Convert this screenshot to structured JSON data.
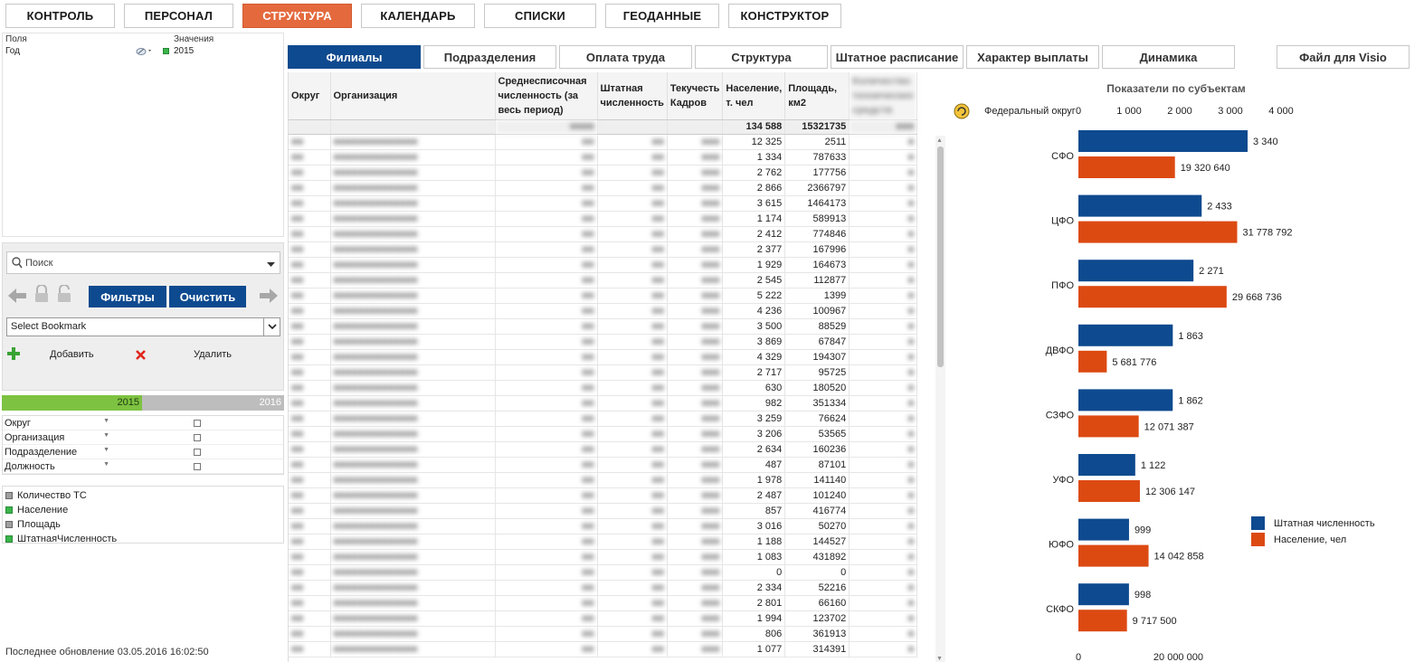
{
  "topnav": [
    {
      "label": "КОНТРОЛЬ",
      "active": false
    },
    {
      "label": "ПЕРСОНАЛ",
      "active": false
    },
    {
      "label": "СТРУКТУРА",
      "active": true
    },
    {
      "label": "КАЛЕНДАРЬ",
      "active": false
    },
    {
      "label": "СПИСКИ",
      "active": false
    },
    {
      "label": "ГЕОДАННЫЕ",
      "active": false
    },
    {
      "label": "КОНСТРУКТОР",
      "active": false
    }
  ],
  "fields": {
    "header_fields": "Поля",
    "header_values": "Значения",
    "field_name": "Год",
    "field_value": "2015"
  },
  "search": {
    "placeholder": "Поиск"
  },
  "toolbar": {
    "filters_label": "Фильтры",
    "clear_label": "Очистить"
  },
  "bookmarks": {
    "select_label": "Select Bookmark",
    "add_label": "Добавить",
    "delete_label": "Удалить"
  },
  "years": {
    "selected": "2015",
    "other": "2016"
  },
  "filters": [
    "Округ",
    "Организация",
    "Подразделение",
    "Должность"
  ],
  "metrics": [
    {
      "label": "Количество ТС",
      "checked": false
    },
    {
      "label": "Население",
      "checked": true
    },
    {
      "label": "Площадь",
      "checked": false
    },
    {
      "label": "ШтатнаяЧисленность",
      "checked": true
    }
  ],
  "last_update": "Последнее обновление 03.05.2016 16:02:50",
  "tabs": [
    "Филиалы",
    "Подразделения",
    "Оплата труда",
    "Структура",
    "Штатное расписание",
    "Характер выплаты",
    "Динамика"
  ],
  "visio_label": "Файл для Visio",
  "table": {
    "headers": [
      "Округ",
      "Организация",
      "Среднесписочная численность (за весь период)",
      "Штатная численность",
      "Текучесть Кадров",
      "Население, т. чел",
      "Площадь, км2",
      "Количество технических средств"
    ],
    "totals": {
      "population": "134 588",
      "area": "15321735"
    },
    "rows": [
      {
        "population": "12 325",
        "area": "2511"
      },
      {
        "population": "1 334",
        "area": "787633"
      },
      {
        "population": "2 762",
        "area": "177756"
      },
      {
        "population": "2 866",
        "area": "2366797"
      },
      {
        "population": "3 615",
        "area": "1464173"
      },
      {
        "population": "1 174",
        "area": "589913"
      },
      {
        "population": "2 412",
        "area": "774846"
      },
      {
        "population": "2 377",
        "area": "167996"
      },
      {
        "population": "1 929",
        "area": "164673"
      },
      {
        "population": "2 545",
        "area": "112877"
      },
      {
        "population": "5 222",
        "area": "1399"
      },
      {
        "population": "4 236",
        "area": "100967"
      },
      {
        "population": "3 500",
        "area": "88529"
      },
      {
        "population": "3 869",
        "area": "67847"
      },
      {
        "population": "4 329",
        "area": "194307"
      },
      {
        "population": "2 717",
        "area": "95725"
      },
      {
        "population": "630",
        "area": "180520"
      },
      {
        "population": "982",
        "area": "351334"
      },
      {
        "population": "3 259",
        "area": "76624"
      },
      {
        "population": "3 206",
        "area": "53565"
      },
      {
        "population": "2 634",
        "area": "160236"
      },
      {
        "population": "487",
        "area": "87101"
      },
      {
        "population": "1 978",
        "area": "141140"
      },
      {
        "population": "2 487",
        "area": "101240"
      },
      {
        "population": "857",
        "area": "416774"
      },
      {
        "population": "3 016",
        "area": "50270"
      },
      {
        "population": "1 188",
        "area": "144527"
      },
      {
        "population": "1 083",
        "area": "431892"
      },
      {
        "population": "0",
        "area": "0"
      },
      {
        "population": "2 334",
        "area": "52216"
      },
      {
        "population": "2 801",
        "area": "66160"
      },
      {
        "population": "1 994",
        "area": "123702"
      },
      {
        "population": "806",
        "area": "361913"
      },
      {
        "population": "1 077",
        "area": "314391"
      }
    ]
  },
  "chart_data": {
    "type": "bar",
    "title": "Показатели по субъектам",
    "dimension_label": "Федеральный округ",
    "categories": [
      "СФО",
      "ЦФО",
      "ПФО",
      "ДВФО",
      "СЗФО",
      "УФО",
      "ЮФО",
      "СКФО"
    ],
    "series": [
      {
        "name": "Штатная численность",
        "color": "#0e4a8f",
        "values": [
          3340,
          2433,
          2271,
          1863,
          1862,
          1122,
          999,
          998
        ],
        "labels": [
          "3 340",
          "2 433",
          "2 271",
          "1 863",
          "1 862",
          "1 122",
          "999",
          "998"
        ],
        "axis_max": 4000,
        "ticks": [
          0,
          1000,
          2000,
          3000,
          4000
        ],
        "tick_labels": [
          "0",
          "1 000",
          "2 000",
          "3 000",
          "4 000"
        ]
      },
      {
        "name": "Население, чел",
        "color": "#dc4a12",
        "values": [
          19320640,
          31778792,
          29668736,
          5681776,
          12071387,
          12306147,
          14042858,
          9717500
        ],
        "labels": [
          "19 320 640",
          "31 778 792",
          "29 668 736",
          "5 681 776",
          "12 071 387",
          "12 306 147",
          "14 042 858",
          "9 717 500"
        ],
        "axis_max": 67000000,
        "ticks": [
          0,
          20000000
        ],
        "tick_labels": [
          "0",
          "20 000 000"
        ]
      }
    ]
  }
}
